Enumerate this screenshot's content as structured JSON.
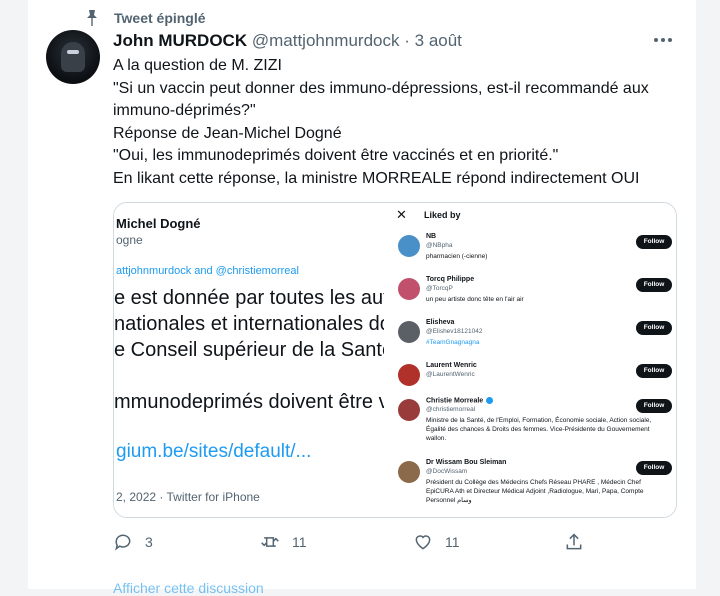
{
  "pinned_label": "Tweet épinglé",
  "author": {
    "name": "John MURDOCK",
    "handle": "@mattjohnmurdock",
    "separator": "·",
    "date": "3 août"
  },
  "body_lines": [
    "A la question de M. ZIZI",
    "\"Si un vaccin peut donner des immuno-dépressions, est-il recommandé aux",
    "immuno-déprimés?\"",
    "Réponse de Jean-Michel Dogné",
    "\"Oui, les immunodeprimés doivent être vaccinés et en priorité.\"",
    "En likant cette réponse, la ministre MORREALE répond indirectement OUI"
  ],
  "embed": {
    "left": {
      "name": "Michel Dogné",
      "sub": "ogne",
      "reply": "attjohnmurdock and @christiemorreal",
      "body_lines": [
        "e est donnée par toutes les autorite",
        " nationales et internationales dont c",
        "e Conseil supérieur de la Santé.",
        "",
        "mmunodeprimés doivent être vaccin"
      ],
      "link": "gium.be/sites/default/...",
      "date": "2, 2022 · Twitter for iPhone"
    },
    "right": {
      "close": "✕",
      "title": "Liked by",
      "follow_label": "Follow",
      "users": [
        {
          "name": "NB",
          "handle": "@NBpha",
          "bio": "pharmacien (-cienne)",
          "color": "#4a90c8",
          "verified": false,
          "bio_link": false
        },
        {
          "name": "Torcq Philippe",
          "handle": "@TorcqP",
          "bio": "un peu artiste donc tête en l'air air",
          "color": "#c0506b",
          "verified": false,
          "bio_link": false
        },
        {
          "name": "Elisheva",
          "handle": "@Elishev18121042",
          "bio": "#TeamGnagnagna",
          "color": "#5b5f66",
          "verified": false,
          "bio_link": true
        },
        {
          "name": "Laurent Wenric",
          "handle": "@LaurentWenric",
          "bio": "",
          "color": "#b0302a",
          "verified": false,
          "bio_link": false
        },
        {
          "name": "Christie Morreale",
          "handle": "@christiemorreal",
          "bio": "Ministre de la Santé, de l'Emploi, Formation, Économie sociale, Action sociale, Égalité des chances & Droits des femmes. Vice-Présidente du Gouvernement wallon.",
          "color": "#9a3b3b",
          "verified": true,
          "bio_link": false
        },
        {
          "name": "Dr Wissam Bou Sleiman",
          "handle": "@DocWissam",
          "bio": "Président du Collège des Médecins Chefs Réseau PHARE , Médecin Chef EpiCURA Ath et Directeur Médical Adjoint ,Radiologue, Mari, Papa, Compte Personnel وسام",
          "color": "#8a6a4a",
          "verified": false,
          "bio_link": false
        }
      ]
    }
  },
  "actions": {
    "replies": "3",
    "retweets": "11",
    "likes": "11"
  },
  "footer_peek": "Afficher cette discussion"
}
